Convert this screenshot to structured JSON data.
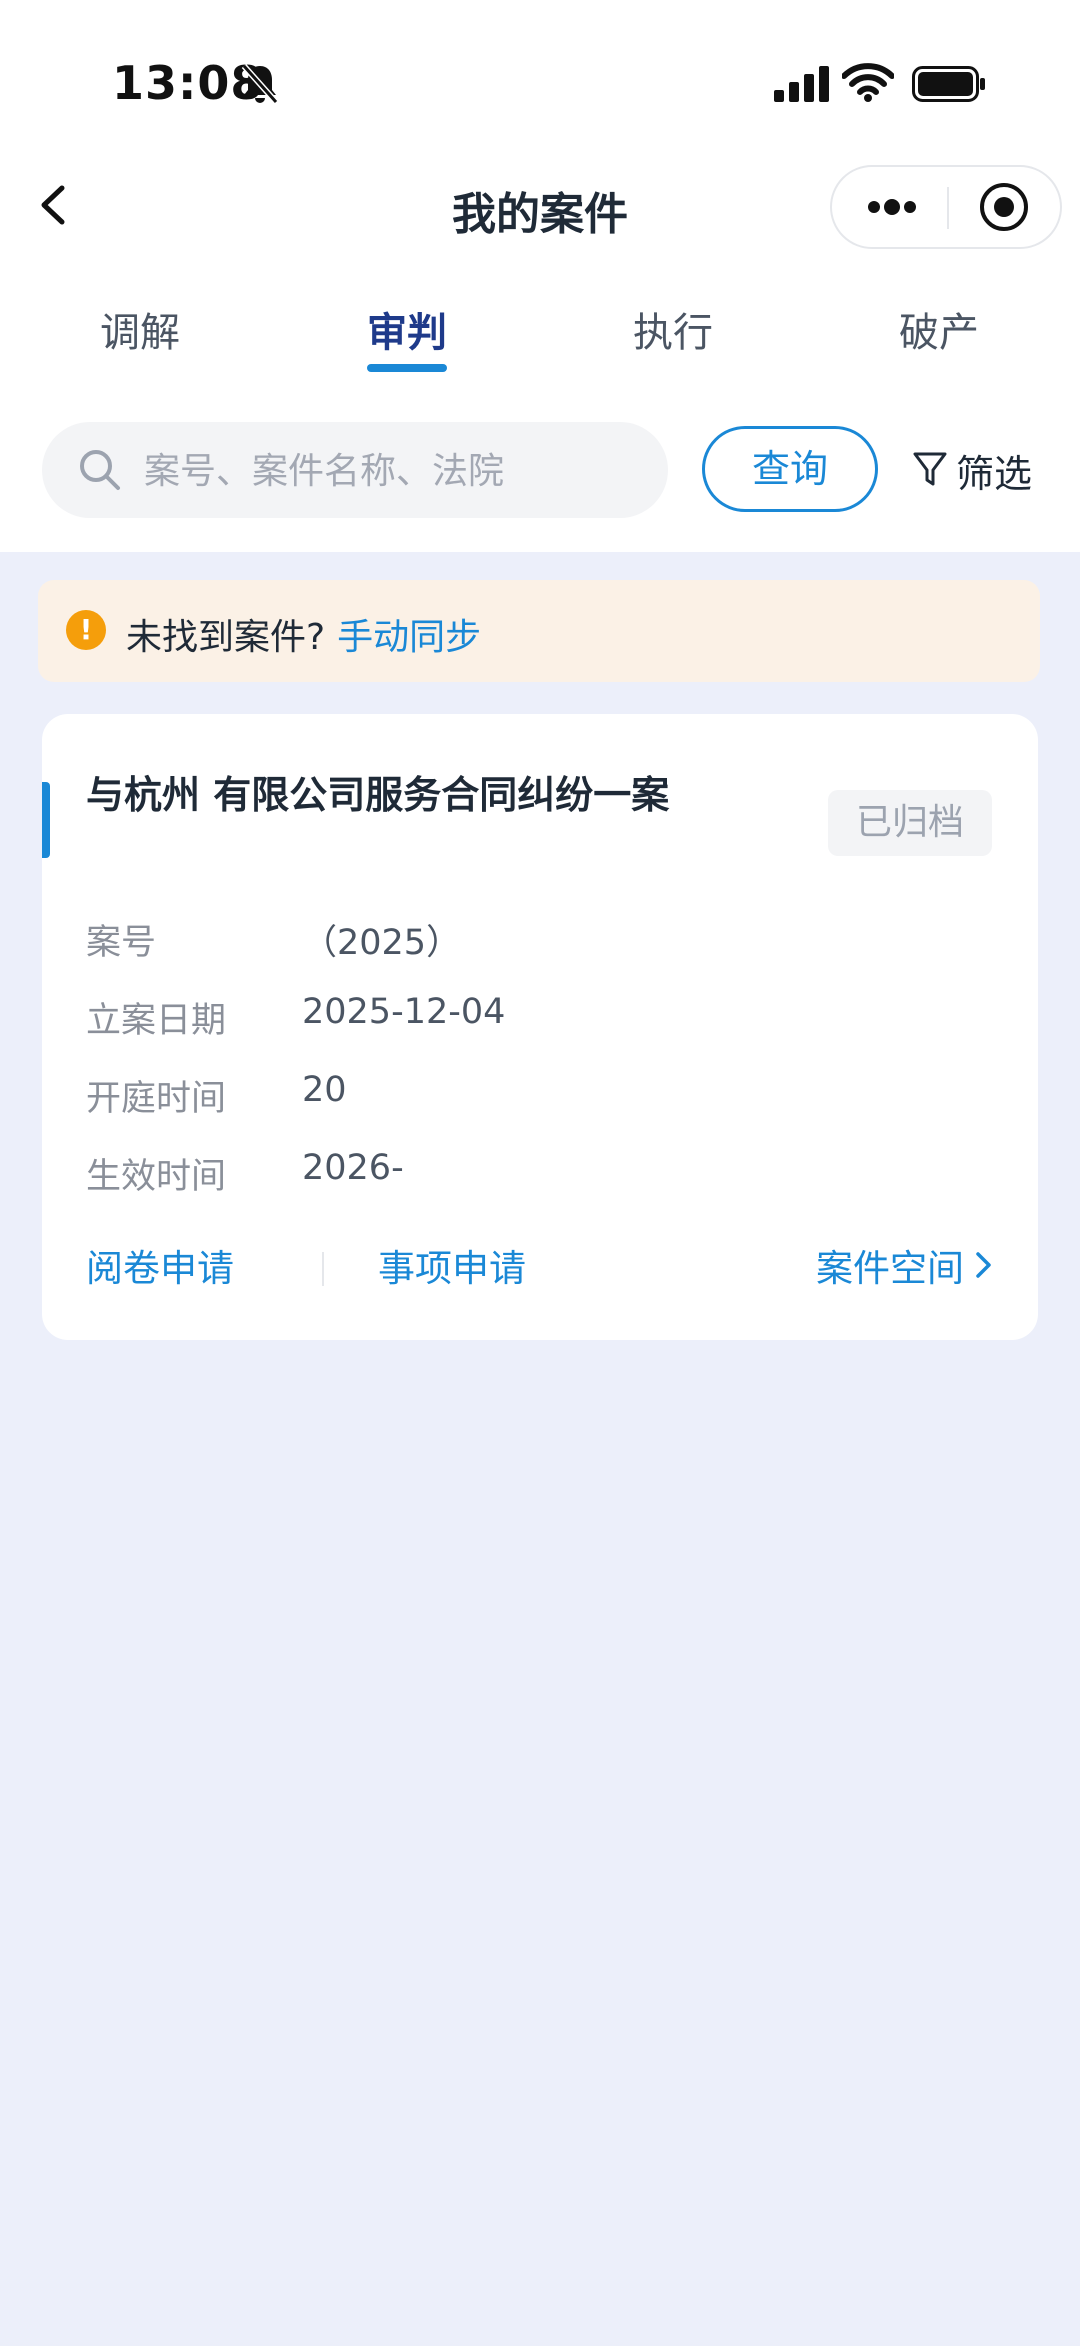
{
  "status_bar": {
    "time": "13:08",
    "icons": [
      "bell-off-icon",
      "signal-icon",
      "wifi-icon",
      "battery-icon"
    ]
  },
  "nav": {
    "title": "我的案件",
    "icons": [
      "back-arrow-icon",
      "more-dots-icon",
      "target-icon"
    ]
  },
  "tabs": [
    {
      "label": "调解",
      "active": false
    },
    {
      "label": "审判",
      "active": true
    },
    {
      "label": "执行",
      "active": false
    },
    {
      "label": "破产",
      "active": false
    }
  ],
  "search": {
    "placeholder": "案号、案件名称、法院",
    "value": "",
    "button_label": "查询",
    "filter_label": "筛选"
  },
  "notice": {
    "text": "未找到案件?",
    "link": "手动同步"
  },
  "case": {
    "title": "与杭州 有限公司服务合同纠纷一案",
    "status": "已归档",
    "fields": [
      {
        "label": "案号",
        "value": "（2025）"
      },
      {
        "label": "立案日期",
        "value": "2025-12-04"
      },
      {
        "label": "开庭时间",
        "value": "20"
      },
      {
        "label": "生效时间",
        "value": "2026-"
      }
    ],
    "actions": {
      "review": "阅卷申请",
      "matters": "事项申请",
      "space": "案件空间"
    }
  },
  "colors": {
    "accent": "#1A88D6",
    "background": "#ECEFFA",
    "notice_bg": "#FBF1E6",
    "warning": "#F59E0B"
  }
}
